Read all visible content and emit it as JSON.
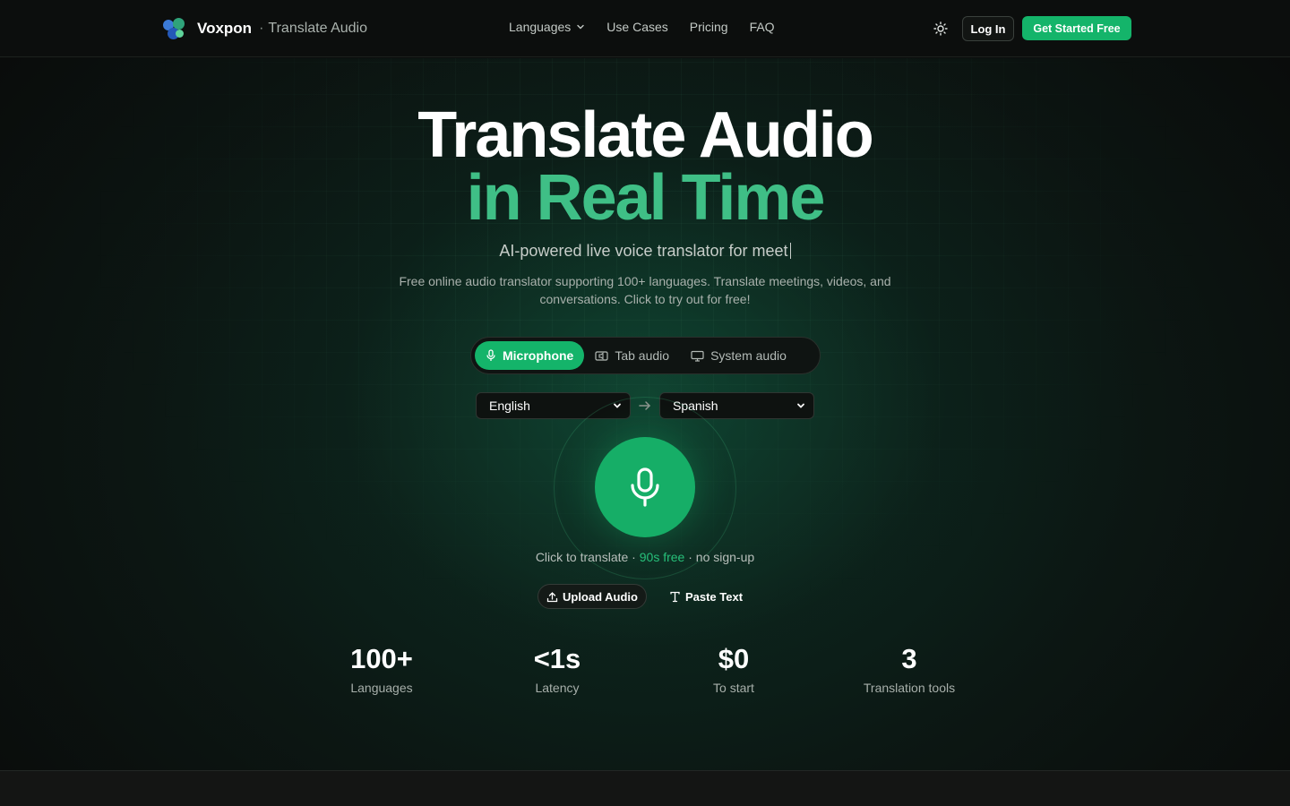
{
  "header": {
    "brand_name": "Voxpon",
    "brand_separator": "·",
    "brand_sub": "Translate Audio",
    "nav": [
      {
        "label": "Languages",
        "has_dropdown": true
      },
      {
        "label": "Use Cases"
      },
      {
        "label": "Pricing"
      },
      {
        "label": "FAQ"
      }
    ],
    "theme_icon": "sun-icon",
    "login_label": "Log In",
    "cta_label": "Get Started Free"
  },
  "hero": {
    "title_line1": "Translate Audio",
    "title_line2": "in Real Time",
    "tagline": "AI-powered live voice translator for meet",
    "description": "Free online audio translator supporting 100+ languages. Translate meetings, videos, and conversations. Click to try out for free!",
    "modes": [
      {
        "label": "Microphone",
        "icon": "microphone-icon",
        "active": true
      },
      {
        "label": "Tab audio",
        "icon": "tab-audio-icon",
        "active": false
      },
      {
        "label": "System audio",
        "icon": "monitor-icon",
        "active": false
      }
    ],
    "source_language": "English",
    "target_language": "Spanish",
    "hint_start": "Click to translate ·",
    "hint_highlight": "90s free",
    "hint_end": "· no sign-up",
    "upload_label": "Upload Audio",
    "paste_label": "Paste Text"
  },
  "stats": [
    {
      "value": "100+",
      "label": "Languages"
    },
    {
      "value": "<1s",
      "label": "Latency"
    },
    {
      "value": "$0",
      "label": "To start"
    },
    {
      "value": "3",
      "label": "Translation tools"
    }
  ],
  "colors": {
    "accent": "#14b46a",
    "accent_text": "#3fbf86",
    "background": "#0b0d0c"
  }
}
